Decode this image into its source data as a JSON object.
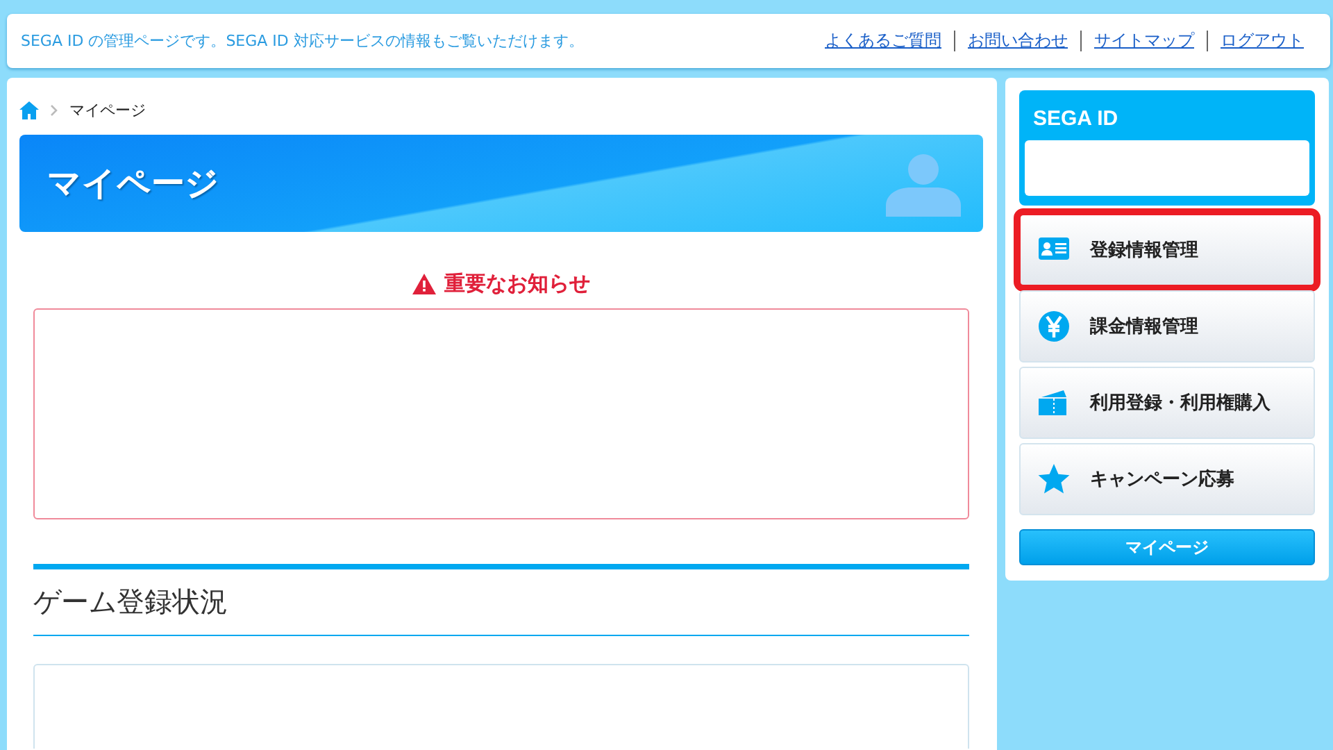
{
  "header": {
    "message": "SEGA ID の管理ページです。SEGA ID 対応サービスの情報もご覧いただけます。",
    "links": [
      "よくあるご質問",
      "お問い合わせ",
      "サイトマップ",
      "ログアウト"
    ]
  },
  "breadcrumb": [
    "マイページ"
  ],
  "banner": {
    "title": "マイページ"
  },
  "notice": {
    "title": "重要なお知らせ"
  },
  "section": {
    "title": "ゲーム登録状況"
  },
  "sidebar": {
    "title": "SEGA ID",
    "items": [
      {
        "label": "登録情報管理",
        "kind": "card",
        "highlighted": true
      },
      {
        "label": "課金情報管理",
        "kind": "yen",
        "highlighted": false
      },
      {
        "label": "利用登録・利用権購入",
        "kind": "ticket",
        "highlighted": false
      },
      {
        "label": "キャンペーン応募",
        "kind": "star",
        "highlighted": false
      }
    ],
    "button": "マイページ"
  }
}
